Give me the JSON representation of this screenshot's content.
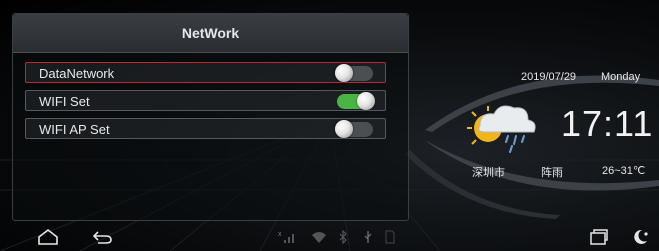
{
  "network_panel": {
    "title": "NetWork",
    "items": [
      {
        "label": "DataNetwork",
        "enabled": false,
        "selected": true
      },
      {
        "label": "WIFI Set",
        "enabled": true,
        "selected": false
      },
      {
        "label": "WIFI AP Set",
        "enabled": false,
        "selected": false
      }
    ]
  },
  "clock_widget": {
    "date": "2019/07/29",
    "day": "Monday",
    "time": "17:11",
    "city": "深圳市",
    "condition": "阵雨",
    "temperature": "26~31℃",
    "weather_icon": "rain-cloud-sun-icon"
  },
  "bottom_bar": {
    "left_icons": [
      "home-icon",
      "back-icon"
    ],
    "status_icons": [
      "signal-off-icon",
      "wifi-icon",
      "bluetooth-icon",
      "usb-icon",
      "sd-card-icon"
    ],
    "right_icons": [
      "recent-apps-icon",
      "night-mode-icon"
    ]
  },
  "colors": {
    "toggle_on": "#4bb543",
    "toggle_off": "#4b4e52",
    "selected_border": "#c0262c"
  }
}
